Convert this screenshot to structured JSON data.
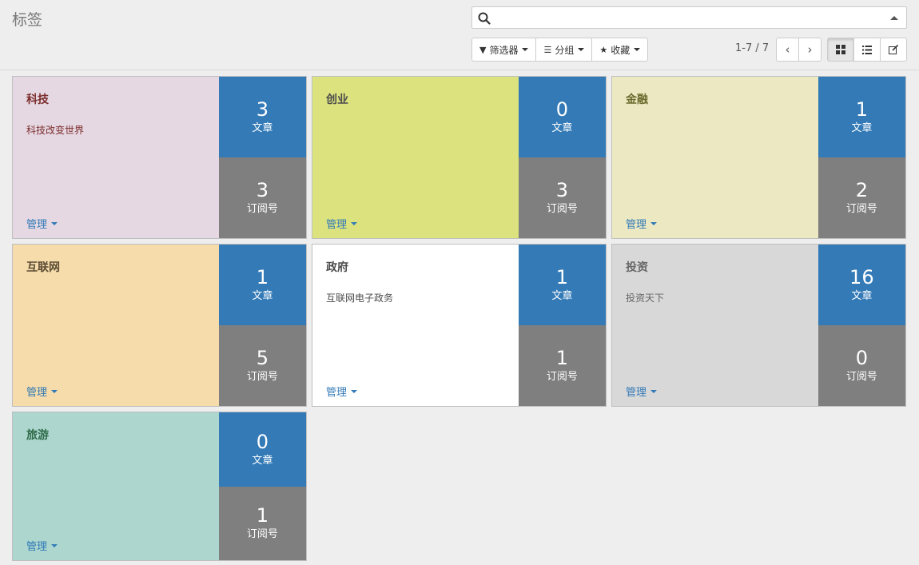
{
  "page": {
    "title": "标签"
  },
  "search": {
    "placeholder": ""
  },
  "toolbar": {
    "filters_label": "筛选器",
    "groupby_label": "分组",
    "favorites_label": "收藏"
  },
  "pager": {
    "value": "1-7 / 7"
  },
  "manage_label": "管理",
  "cards": [
    {
      "title": "科技",
      "description": "科技改变世界",
      "posts": "3",
      "posts_label": "文章",
      "subscribers": "3",
      "subscribers_label": "订阅号",
      "color": "#e5d8e2",
      "title_color": "#7b2c2c",
      "desc_color": "#7b2c2c"
    },
    {
      "title": "创业",
      "description": "",
      "posts": "0",
      "posts_label": "文章",
      "subscribers": "3",
      "subscribers_label": "订阅号",
      "color": "#dbe27e",
      "title_color": "#4c4c4c",
      "desc_color": "#4c4c4c"
    },
    {
      "title": "金融",
      "description": "",
      "posts": "1",
      "posts_label": "文章",
      "subscribers": "2",
      "subscribers_label": "订阅号",
      "color": "#ebe8c2",
      "title_color": "#6b6b2e",
      "desc_color": "#6b6b2e"
    },
    {
      "title": "互联网",
      "description": "",
      "posts": "1",
      "posts_label": "文章",
      "subscribers": "5",
      "subscribers_label": "订阅号",
      "color": "#f5dcaa",
      "title_color": "#5a4a33",
      "desc_color": "#5a4a33"
    },
    {
      "title": "政府",
      "description": "互联网电子政务",
      "posts": "1",
      "posts_label": "文章",
      "subscribers": "1",
      "subscribers_label": "订阅号",
      "color": "#ffffff",
      "title_color": "#4c4c4c",
      "desc_color": "#4c4c4c"
    },
    {
      "title": "投资",
      "description": "投资天下",
      "posts": "16",
      "posts_label": "文章",
      "subscribers": "0",
      "subscribers_label": "订阅号",
      "color": "#d8d8d8",
      "title_color": "#666666",
      "desc_color": "#666666"
    },
    {
      "title": "旅游",
      "description": "",
      "posts": "0",
      "posts_label": "文章",
      "subscribers": "1",
      "subscribers_label": "订阅号",
      "color": "#acd6ce",
      "title_color": "#2f6b4a",
      "desc_color": "#2f6b4a"
    }
  ],
  "icons": {
    "search": "search-icon",
    "filter": "filter-icon",
    "groupby": "bars-icon",
    "favorites": "star-icon",
    "prev": "chevron-left-icon",
    "next": "chevron-right-icon",
    "kanban": "kanban-view-icon",
    "list": "list-view-icon",
    "edit": "edit-icon"
  }
}
